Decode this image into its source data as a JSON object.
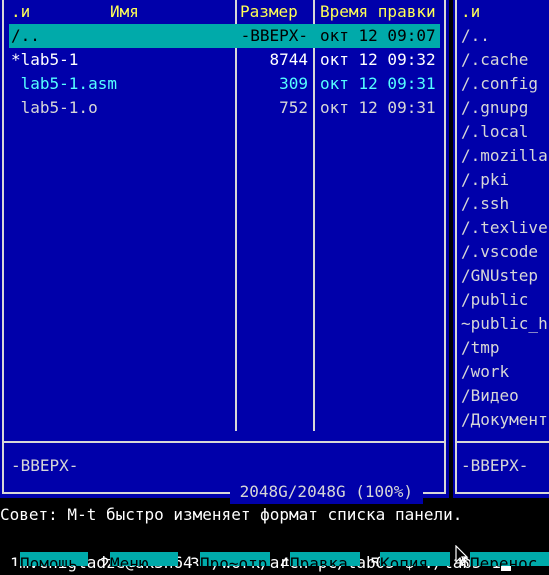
{
  "left_panel": {
    "headers": {
      "sort": ".и",
      "name": "Имя",
      "size": "Размер",
      "mtime": "Время правки"
    },
    "rows": [
      {
        "name": "/..",
        "size": "-ВВЕРХ-",
        "mtime": "окт 12 09:07",
        "selected": true
      },
      {
        "name": "*lab5-1",
        "size": "8744",
        "mtime": "окт 12 09:32",
        "kind": "executable"
      },
      {
        "name": " lab5-1.asm",
        "size": "309",
        "mtime": "окт 12 09:31",
        "kind": "source"
      },
      {
        "name": " lab5-1.o",
        "size": "752",
        "mtime": "окт 12 09:31",
        "kind": "file"
      }
    ],
    "status": "-ВВЕРХ-",
    "disk_info": " 2048G/2048G (100%) "
  },
  "right_panel": {
    "header": ".и",
    "items": [
      "/..",
      "/.cache",
      "/.config",
      "/.gnupg",
      "/.local",
      "/.mozilla",
      "/.pki",
      "/.ssh",
      "/.texlive",
      "/.vscode",
      "/GNUstep",
      "/public",
      "~public_h",
      "/tmp",
      "/work",
      "/Видео",
      "/Документ"
    ],
    "status": "-ВВЕРХ-"
  },
  "hint": "Совет: M-t быстро изменяет формат списка панели.",
  "command_line": {
    "prompt": "mvchigladze@dk3n64 ~/work/arch-pc/lab05 $ ",
    "input": "./lab5-1"
  },
  "function_keys": [
    {
      "num": "1",
      "label": "Помощь"
    },
    {
      "num": "2",
      "label": "Меню"
    },
    {
      "num": "3",
      "label": "Про~отр"
    },
    {
      "num": "4",
      "label": "Правка"
    },
    {
      "num": "5",
      "label": "Копия"
    },
    {
      "num": "6",
      "label": "Перенос"
    }
  ],
  "colors": {
    "panel_bg": "#0000aa",
    "selection": "#00aaaa",
    "header": "#ffff55",
    "source_file": "#55ffff",
    "executable": "#ffffff"
  }
}
